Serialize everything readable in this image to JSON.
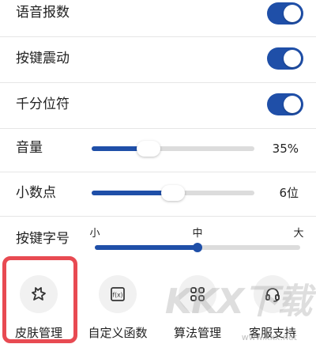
{
  "settings": {
    "voice_announce": {
      "label": "语音报数",
      "on": true
    },
    "key_vibration": {
      "label": "按键震动",
      "on": true
    },
    "thousands_separator": {
      "label": "千分位符",
      "on": true
    },
    "volume": {
      "label": "音量",
      "value_text": "35%",
      "percent": 35
    },
    "decimal_places": {
      "label": "小数点",
      "value_text": "6位",
      "percent": 50
    },
    "key_font_size": {
      "label": "按键字号",
      "ticks": [
        "小",
        "中",
        "大"
      ],
      "selected": "中"
    }
  },
  "toolbar": {
    "items": [
      {
        "label": "皮肤管理",
        "icon": "skin-icon"
      },
      {
        "label": "自定义函数",
        "icon": "function-icon"
      },
      {
        "label": "算法管理",
        "icon": "grid-icon"
      },
      {
        "label": "客服支持",
        "icon": "headset-icon"
      }
    ]
  },
  "watermark": {
    "text": "KKX下载",
    "url": "www.kkx.net"
  },
  "colors": {
    "accent": "#1f4fa8",
    "highlight": "#e84a52",
    "track": "#dcdcdc"
  }
}
